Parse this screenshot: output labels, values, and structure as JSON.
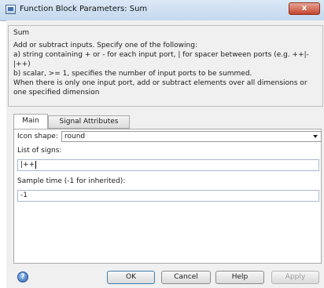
{
  "window": {
    "title": "Function Block Parameters: Sum",
    "close_glyph": "x"
  },
  "block": {
    "name": "Sum",
    "description": "Add or subtract inputs.  Specify one of the following:\na) string containing + or - for each input port, | for spacer between ports (e.g. ++|-|++)\nb) scalar, >= 1, specifies the number of input ports to be summed.\nWhen there is only one input port, add or subtract elements over all dimensions or one specified dimension"
  },
  "tabs": [
    {
      "label": "Main",
      "active": true
    },
    {
      "label": "Signal Attributes",
      "active": false
    }
  ],
  "params": {
    "icon_shape": {
      "label": "Icon shape:",
      "value": "round"
    },
    "list_of_signs": {
      "label": "List of signs:",
      "value": "|++"
    },
    "sample_time": {
      "label": "Sample time (-1 for inherited):",
      "value": "-1"
    }
  },
  "buttons": {
    "ok": "OK",
    "cancel": "Cancel",
    "help": "Help",
    "apply": "Apply"
  },
  "icons": {
    "app": "simulink-block-icon",
    "help": "question-circle-icon",
    "close": "close-icon",
    "dropdown": "chevron-down-icon"
  }
}
